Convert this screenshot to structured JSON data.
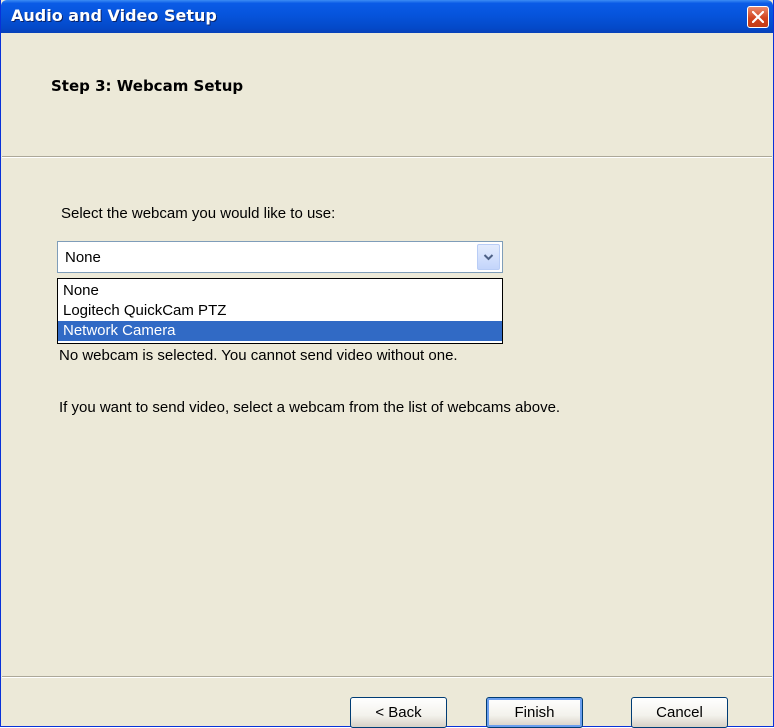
{
  "window": {
    "title": "Audio and Video Setup"
  },
  "header": {
    "step_title": "Step 3: Webcam Setup"
  },
  "main": {
    "prompt": "Select the webcam you would like to use:",
    "select_value": "None",
    "options": [
      {
        "label": "None",
        "highlighted": false
      },
      {
        "label": "Logitech QuickCam PTZ",
        "highlighted": false
      },
      {
        "label": "Network Camera",
        "highlighted": true
      }
    ],
    "status_message": "No webcam is selected. You cannot send video without one.",
    "hint_message": "If you want to send video, select a webcam from the list of webcams above."
  },
  "footer": {
    "back_label": "< Back",
    "finish_label": "Finish",
    "cancel_label": "Cancel"
  },
  "colors": {
    "titlebar": "#0654dc",
    "highlight": "#316ac5",
    "dialog_bg": "#ece9d8"
  },
  "icons": {
    "close": "close-icon",
    "dropdown": "chevron-down-icon"
  }
}
